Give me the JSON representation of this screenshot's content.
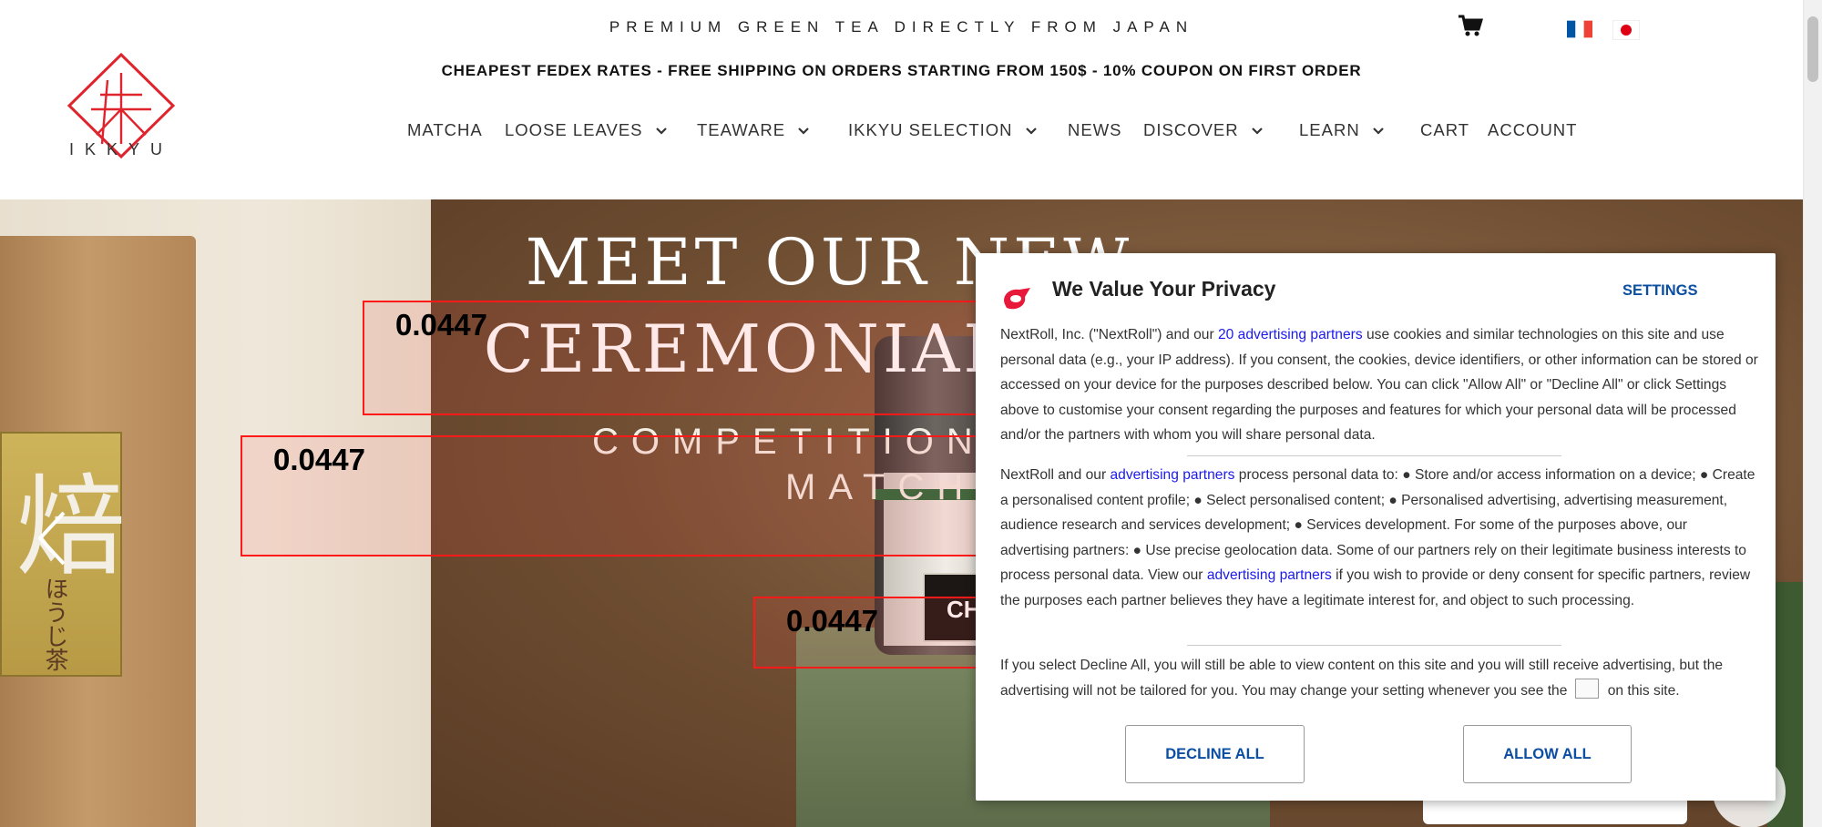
{
  "header": {
    "tagline": "PREMIUM GREEN TEA DIRECTLY FROM JAPAN",
    "promo": "CHEAPEST FEDEX RATES - FREE SHIPPING ON ORDERS STARTING FROM 150$ - 10% COUPON ON FIRST ORDER",
    "logo_text": "IKKYU",
    "languages": [
      "French",
      "Japanese"
    ],
    "nav": [
      {
        "label": "MATCHA",
        "dropdown": false
      },
      {
        "label": "LOOSE LEAVES",
        "dropdown": true
      },
      {
        "label": "TEAWARE",
        "dropdown": true
      },
      {
        "label": "IKKYU SELECTION",
        "dropdown": true
      },
      {
        "label": "NEWS",
        "dropdown": false
      },
      {
        "label": "DISCOVER",
        "dropdown": true
      },
      {
        "label": "LEARN",
        "dropdown": true
      },
      {
        "label": "CART",
        "dropdown": false
      },
      {
        "label": "ACCOUNT",
        "dropdown": false
      }
    ]
  },
  "hero": {
    "title_line1": "MEET OUR NEW",
    "title_line2": "CEREMONIAL",
    "subtitle_line1": "COMPETITION A",
    "subtitle_line2": "MATCHA",
    "cta_label": "CH",
    "package_kanji": "焙",
    "package_small": "ほうじ茶"
  },
  "annotations": [
    {
      "label": "0.0447"
    },
    {
      "label": "0.0447"
    },
    {
      "label": "0.0447"
    }
  ],
  "consent": {
    "title": "We Value Your Privacy",
    "settings_label": "SETTINGS",
    "p1_pre": "NextRoll, Inc. (\"NextRoll\") and our ",
    "p1_link": "20 advertising partners",
    "p1_post": " use cookies and similar technologies on this site and use personal data (e.g., your IP address). If you consent, the cookies, device identifiers, or other information can be stored or accessed on your device for the purposes described below. You can click \"Allow All\" or \"Decline All\" or click Settings above to customise your consent regarding the purposes and features for which your personal data will be processed and/or the partners with whom you will share personal data.",
    "p2_pre": "NextRoll and our ",
    "p2_link": "advertising partners",
    "p2_mid": " process personal data to: ● Store and/or access information on a device; ● Create a personalised content profile; ● Select personalised content; ● Personalised advertising, advertising measurement, audience research and services development; ● Services development. For some of the purposes above, our advertising partners: ● Use precise geolocation data. Some of our partners rely on their legitimate business interests to process personal data. View our ",
    "p2_link2": "advertising partners",
    "p2_post": " if you wish to provide or deny consent for specific partners, review the purposes each partner believes they have a legitimate interest for, and object to such processing.",
    "p3_pre": "If you select Decline All, you will still be able to view content on this site and you will still receive advertising, but the advertising will not be tailored for you. You may change your setting whenever you see the",
    "p3_post": "on this site.",
    "decline_label": "DECLINE ALL",
    "allow_label": "ALLOW ALL",
    "accent_color": "#0b4ea2",
    "brand_color": "#e8183a"
  }
}
